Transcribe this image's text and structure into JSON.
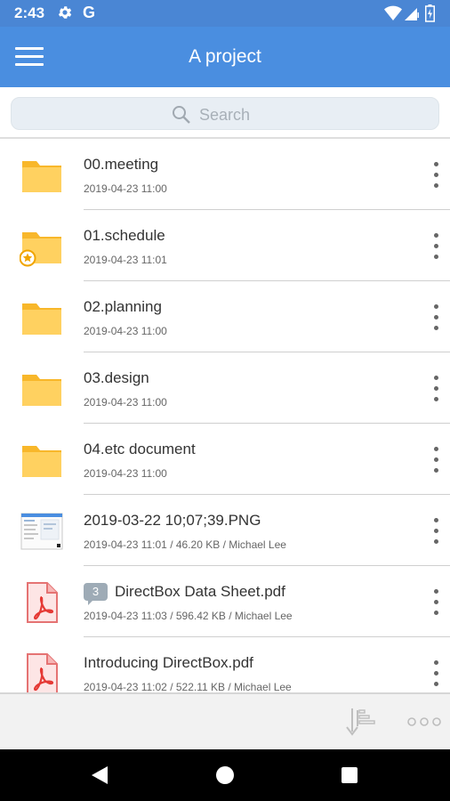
{
  "status_bar": {
    "time": "2:43",
    "g_label": "G",
    "icons": [
      "gear-icon",
      "google-icon",
      "wifi-icon",
      "cell-signal-icon",
      "battery-icon"
    ]
  },
  "app_bar": {
    "title": "A project",
    "menu_icon": "hamburger-menu-icon"
  },
  "search": {
    "placeholder": "Search"
  },
  "colors": {
    "app_bar": "#4a8ee0",
    "status_bar": "#4a86d4",
    "folder": "#fbc02d",
    "pdf": "#e57373"
  },
  "files": [
    {
      "name": "00.meeting",
      "meta": "2019-04-23 11:00",
      "type": "folder"
    },
    {
      "name": "01.schedule",
      "meta": "2019-04-23 11:01",
      "type": "folder-starred"
    },
    {
      "name": "02.planning",
      "meta": "2019-04-23 11:00",
      "type": "folder"
    },
    {
      "name": "03.design",
      "meta": "2019-04-23 11:00",
      "type": "folder"
    },
    {
      "name": "04.etc document",
      "meta": "2019-04-23 11:00",
      "type": "folder"
    },
    {
      "name": "2019-03-22 10;07;39.PNG",
      "meta": "2019-04-23 11:01 / 46.20 KB / Michael Lee",
      "type": "image"
    },
    {
      "name": "DirectBox Data Sheet.pdf",
      "meta": "2019-04-23 11:03 / 596.42 KB / Michael Lee",
      "type": "pdf",
      "comments": "3"
    },
    {
      "name": "Introducing DirectBox.pdf",
      "meta": "2019-04-23 11:02 / 522.11 KB / Michael Lee",
      "type": "pdf"
    }
  ],
  "bottom_bar": {
    "icons": [
      "sort-icon",
      "more-horizontal-icon"
    ]
  },
  "nav_bar": {
    "icons": [
      "back-icon",
      "home-icon",
      "recents-icon"
    ]
  }
}
